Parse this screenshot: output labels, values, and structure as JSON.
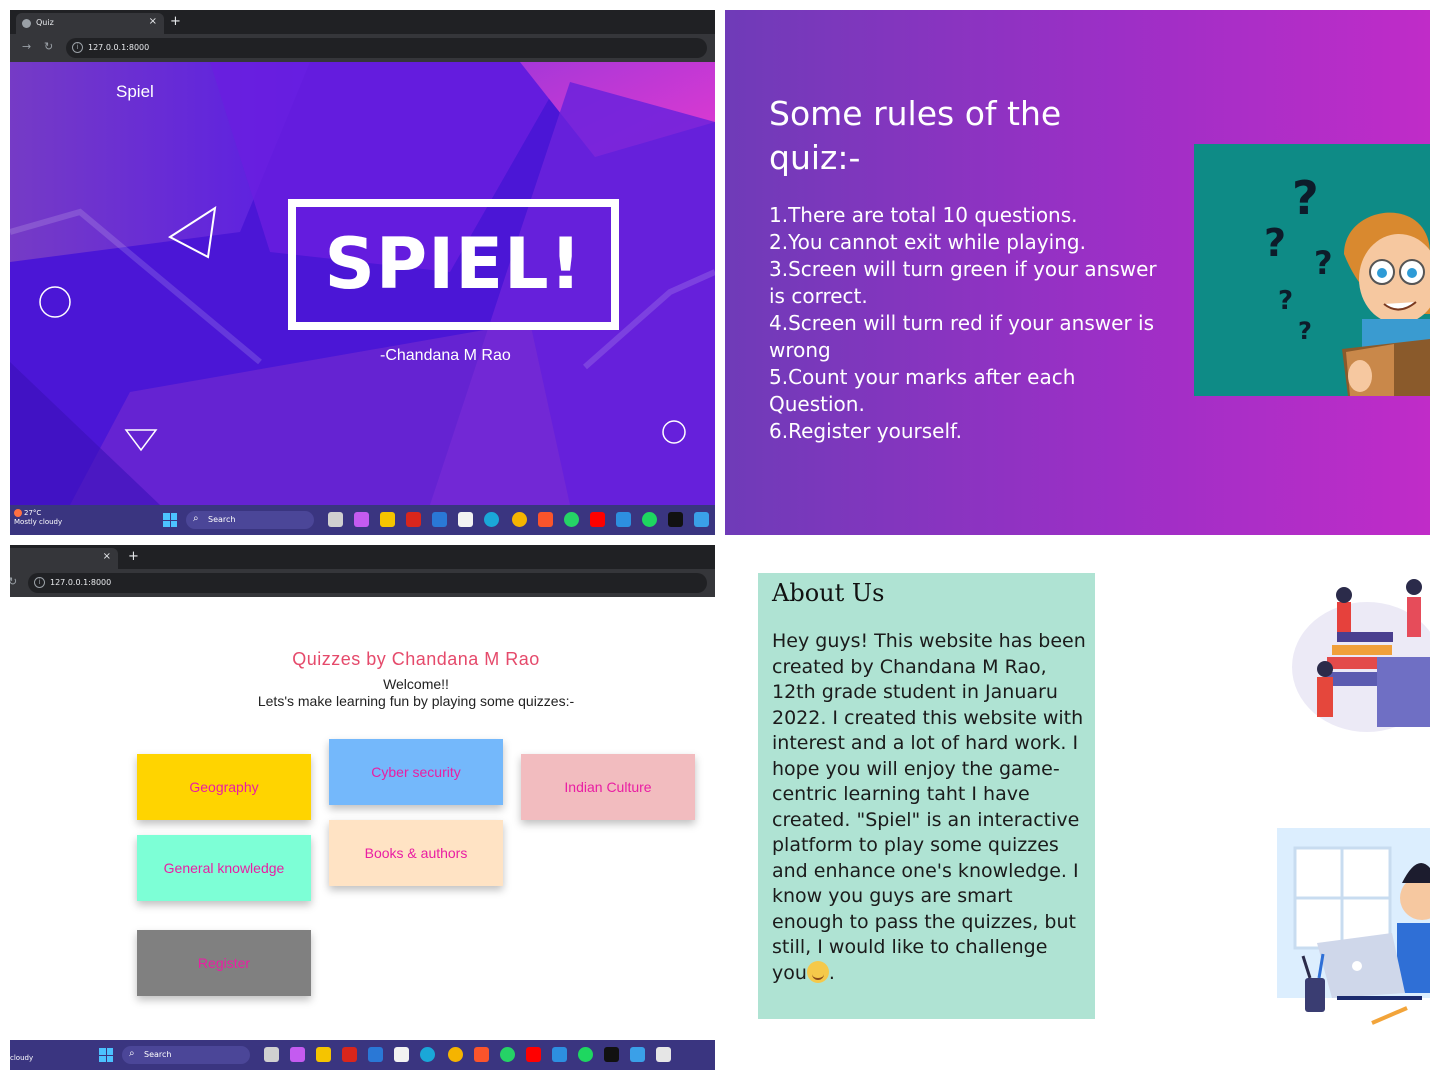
{
  "browser": {
    "tab_title": "Quiz",
    "tab_close": "×",
    "new_tab": "+",
    "url": "127.0.0.1:8000"
  },
  "taskbar": {
    "temperature": "27°C",
    "weather": "Mostly cloudy",
    "weather_short": "cloudy",
    "search_label": "Search"
  },
  "hero": {
    "brand": "Spiel",
    "logo": "SPIEL!",
    "author": "-Chandana M Rao"
  },
  "rules": {
    "title": "Some rules of the quiz:-",
    "items": [
      "1.There are total 10 questions.",
      "2.You cannot exit while playing.",
      "3.Screen will turn green if your answer is correct.",
      "4.Screen will turn red if your answer is wrong",
      "5.Count your marks after each Question.",
      "6.Register yourself."
    ]
  },
  "quizzes": {
    "title": "Quizzes by Chandana M Rao",
    "welcome": "Welcome!!",
    "subtitle": "Lets's make learning fun by playing some quizzes:-",
    "buttons": [
      {
        "label": "Geography",
        "color": "#ffd400"
      },
      {
        "label": "Cyber security",
        "color": "#74b8fb"
      },
      {
        "label": "Indian Culture",
        "color": "#f2bcbf"
      },
      {
        "label": "General knowledge",
        "color": "#7dffd6"
      },
      {
        "label": "Books & authors",
        "color": "#ffe3c4"
      },
      {
        "label": "Register",
        "color": "#808080"
      }
    ]
  },
  "about": {
    "title": "About Us",
    "text": "Hey guys! This website has been created by Chandana M Rao, 12th grade student in Januaru 2022. I created this website with interest and a lot of hard work. I hope you will enjoy the game-centric learning taht I have created. \"Spiel\" is an interactive platform to play some quizzes and enhance one's knowledge. I know you guys are smart enough to pass the quizzes, but still, I would like to challenge you",
    "text_end": "."
  },
  "colors": {
    "hero_bg": "#4b16d6",
    "rules_gradient": [
      "#6f3bb8",
      "#c02cc8"
    ],
    "quiz_title": "#e54a6b",
    "quiz_button_text": "#e91ea3",
    "about_bg": "#afe3d3",
    "taskbar_bg": "#3a3580"
  },
  "icons": [
    "search-icon",
    "windows-start-icon",
    "reload-icon",
    "forward-icon",
    "site-info-icon",
    "close-tab-icon",
    "smile-emoji-icon"
  ]
}
